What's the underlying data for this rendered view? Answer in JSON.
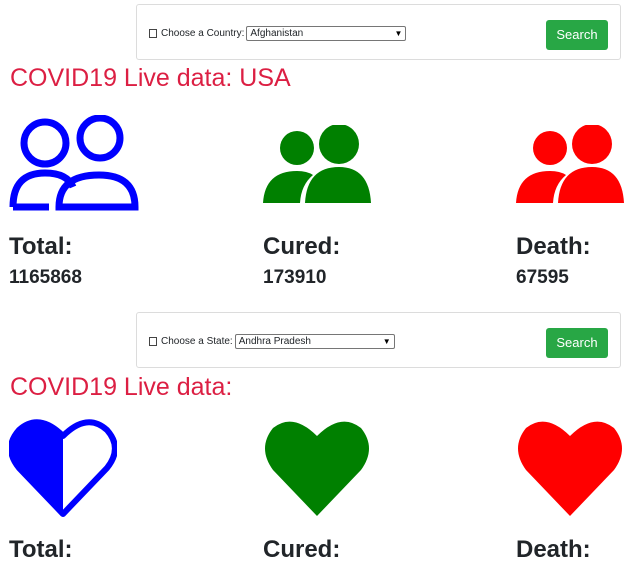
{
  "country_search": {
    "label": "Choose a Country:",
    "selected": "Afghanistan",
    "button_label": "Search"
  },
  "country_section": {
    "heading": "COVID19 Live data: USA",
    "stats": [
      {
        "label": "Total:",
        "value": "1165868",
        "icon": "users-outline-icon",
        "color": "#0000ff"
      },
      {
        "label": "Cured:",
        "value": "173910",
        "icon": "users-icon",
        "color": "#008000"
      },
      {
        "label": "Death:",
        "value": "67595",
        "icon": "users-icon",
        "color": "#ff0000"
      }
    ]
  },
  "state_search": {
    "label": "Choose a State:",
    "selected": "Andhra Pradesh",
    "button_label": "Search"
  },
  "state_section": {
    "heading": "COVID19 Live data:",
    "stats": [
      {
        "label": "Total:",
        "icon": "heart-half-icon",
        "color": "#0000ff"
      },
      {
        "label": "Cured:",
        "icon": "heart-icon",
        "color": "#008000"
      },
      {
        "label": "Death:",
        "icon": "heart-icon",
        "color": "#ff0000"
      }
    ]
  }
}
